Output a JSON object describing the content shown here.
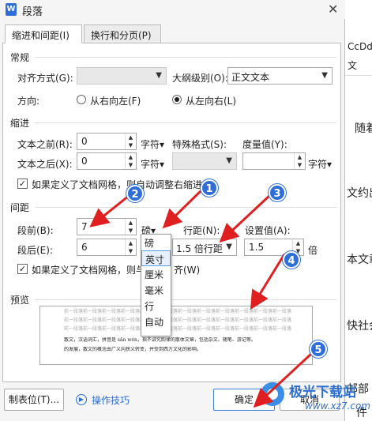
{
  "window": {
    "title": "段落",
    "app_icon_letter": "W"
  },
  "tabs": [
    {
      "label": "缩进和间距(I)",
      "active": true
    },
    {
      "label": "换行和分页(P)",
      "active": false
    }
  ],
  "general": {
    "section_label": "常规",
    "alignment_label": "对齐方式(G):",
    "alignment_value": "",
    "outline_label": "大纲级别(O):",
    "outline_value": "正文文本",
    "direction_label": "方向:",
    "rtl_label": "从右向左(F)",
    "ltr_label": "从左向右(L)"
  },
  "indent": {
    "section_label": "缩进",
    "before_label": "文本之前(R):",
    "before_value": "0",
    "before_unit": "字符▾",
    "after_label": "文本之后(X):",
    "after_value": "0",
    "after_unit": "字符▾",
    "special_label": "特殊格式(S):",
    "special_value": "",
    "measure_label": "度量值(Y):",
    "measure_value": "",
    "measure_unit": "字符▾",
    "auto_adjust_label": "如果定义了文档网格，则自动调整右缩进"
  },
  "spacing": {
    "section_label": "间距",
    "before_label": "段前(B):",
    "before_value": "7",
    "before_unit": "磅▾",
    "after_label": "段后(E):",
    "after_value": "6",
    "line_label": "行距(N):",
    "line_value": "1.5 倍行距",
    "setting_label": "设置值(A):",
    "setting_value": "1.5",
    "setting_unit": "倍",
    "grid_label_left": "如果定义了文档网格，则与",
    "grid_label_right": "齐(W)",
    "unit_menu": [
      "磅",
      "英寸",
      "厘米",
      "毫米",
      "行",
      "自动"
    ],
    "unit_menu_highlighted": "英寸"
  },
  "preview": {
    "section_label": "预览",
    "ghost_text": "前一段落前一段落前一段落前一段落前一段落前一段落前一段落前一段落前一段落前一段落前一段落前一段落",
    "body_text_1": "散文，汉语词汇，拼音是 sǎn wén，指不讲究韵律的散体文章，包括杂文、随笔、游记等。",
    "body_text_2": "的发展，散文的概念由广义向狭义转变，并受到西方文化的影响。"
  },
  "buttons": {
    "tabs_button": "制表位(T)...",
    "tips_link": "操作技巧",
    "ok": "确定",
    "cancel": "取消"
  },
  "annotations": [
    "1",
    "2",
    "3",
    "4",
    "5"
  ],
  "background_doc": {
    "snippets": [
      "CcDd",
      "文",
      "随着",
      "文约出",
      "本文章",
      "快社会",
      "邮部",
      "件"
    ]
  },
  "watermark": {
    "title": "极光下载站",
    "url": "www.xz7.com"
  },
  "colors": {
    "accent": "#2f6ed8",
    "arrow_red": "#e02020"
  }
}
